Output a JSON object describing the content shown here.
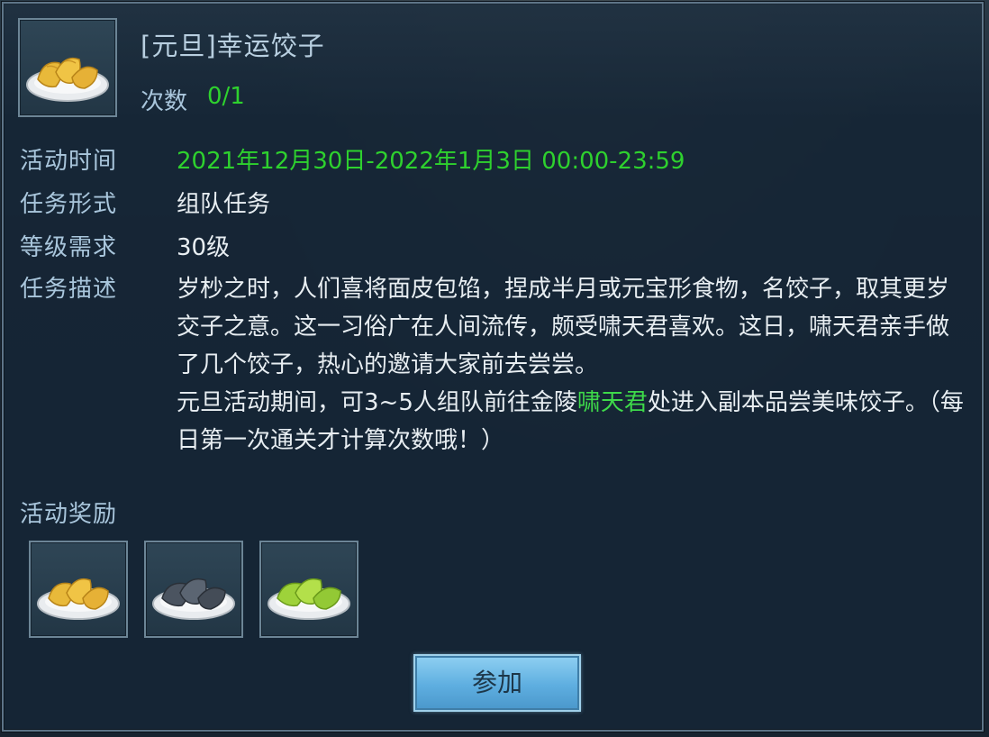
{
  "quest": {
    "title": "[元旦]幸运饺子",
    "count_label": "次数",
    "count_value": "0/1"
  },
  "rows": {
    "time_label": "活动时间",
    "time_value": "2021年12月30日-2022年1月3日 00:00-23:59",
    "form_label": "任务形式",
    "form_value": "组队任务",
    "level_label": "等级需求",
    "level_value": "30级",
    "desc_label": "任务描述"
  },
  "description": {
    "para1": "岁杪之时，人们喜将面皮包馅，捏成半月或元宝形食物，名饺子，取其更岁交子之意。这一习俗广在人间流传，颇受啸天君喜欢。这日，啸天君亲手做了几个饺子，热心的邀请大家前去尝尝。",
    "para2_before": "元旦活动期间，可3~5人组队前往金陵",
    "para2_highlight": "啸天君",
    "para2_after": "处进入副本品尝美味饺子。（每日第一次通关才计算次数哦！）"
  },
  "rewards": {
    "label": "活动奖励",
    "items": [
      {
        "icon": "golden-dumplings-icon"
      },
      {
        "icon": "black-dumplings-icon"
      },
      {
        "icon": "green-dumplings-icon"
      }
    ]
  },
  "button": {
    "join_label": "参加"
  },
  "colors": {
    "label": "#a9c6dc",
    "value": "#e8eef2",
    "accent_green": "#2ed12e",
    "button": "#5eaee0"
  }
}
